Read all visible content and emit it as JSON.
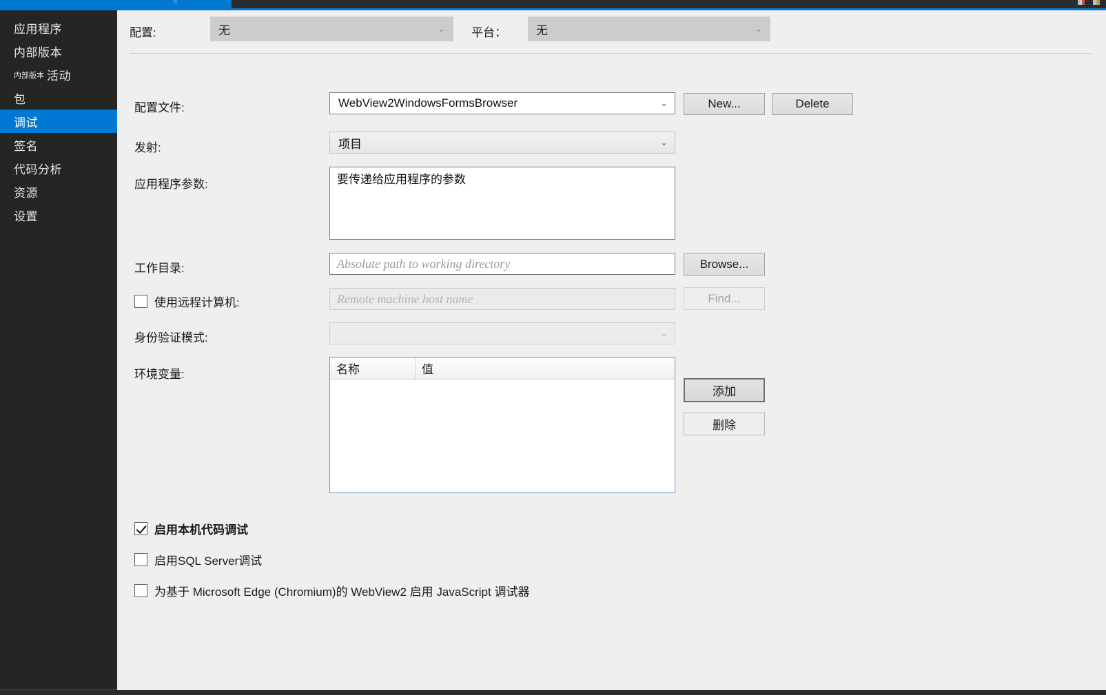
{
  "window": {
    "title_bar_accent": "#0078d4",
    "chrome_dark": "#2b2b2b"
  },
  "sidebar": {
    "items": [
      {
        "label": "应用程序",
        "selected": false,
        "prefix": ""
      },
      {
        "label": "内部版本",
        "selected": false,
        "prefix": ""
      },
      {
        "label": "活动",
        "selected": false,
        "prefix": "内部版本"
      },
      {
        "label": "包",
        "selected": false,
        "prefix": ""
      },
      {
        "label": "调试",
        "selected": true,
        "prefix": ""
      },
      {
        "label": "签名",
        "selected": false,
        "prefix": ""
      },
      {
        "label": "代码分析",
        "selected": false,
        "prefix": ""
      },
      {
        "label": "资源",
        "selected": false,
        "prefix": ""
      },
      {
        "label": "设置",
        "selected": false,
        "prefix": ""
      }
    ]
  },
  "header": {
    "configuration_label": "配置:",
    "configuration_value": "无",
    "platform_label": "平台：",
    "platform_value": "无",
    "chevron": "⌄"
  },
  "form": {
    "profile_label": "配置文件:",
    "profile_value": "WebView2WindowsFormsBrowser",
    "new_button": "New...",
    "delete_button": "Delete",
    "launch_label": "发射:",
    "launch_value": "项目",
    "app_args_label": "应用程序参数:",
    "app_args_value": "要传递给应用程序的参数",
    "working_dir_label": "工作目录:",
    "working_dir_placeholder": "Absolute path to working directory",
    "browse_button": "Browse...",
    "remote_machine_label": "使用远程计算机:",
    "remote_machine_placeholder": "Remote machine host name",
    "find_button": "Find...",
    "auth_mode_label": "身份验证模式:",
    "auth_mode_value": "",
    "env_vars_label": "环境变量:",
    "env_col_name": "名称",
    "env_col_value": "值",
    "env_rows": [],
    "add_button": "添加",
    "remove_button": "删除"
  },
  "checkboxes": [
    {
      "label": "启用本机代码调试",
      "checked": true
    },
    {
      "label": "启用SQL Server调试",
      "checked": false
    },
    {
      "label": "为基于 Microsoft Edge (Chromium)的 WebView2 启用 JavaScript 调试器",
      "checked": false
    }
  ]
}
